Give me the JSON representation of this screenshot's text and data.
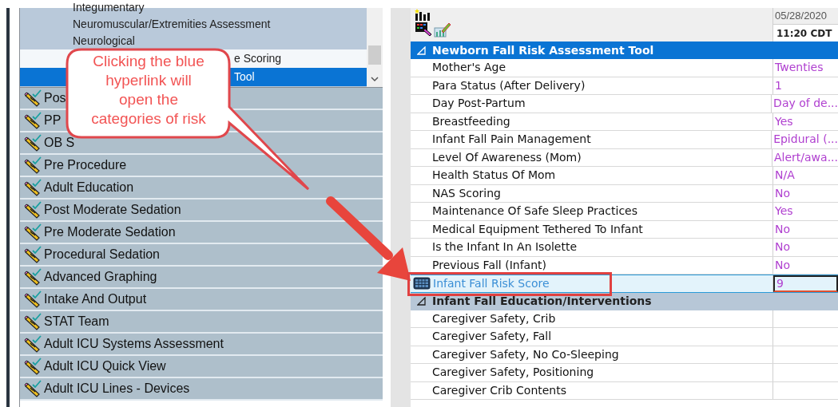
{
  "left_panel": {
    "list_items": [
      {
        "label": "Integumentary",
        "selected": false,
        "highlighted": false
      },
      {
        "label": "Neuromuscular/Extremities Assessment",
        "selected": false,
        "highlighted": false
      },
      {
        "label": "Neurological",
        "selected": false,
        "highlighted": false
      },
      {
        "label": "e Scoring",
        "selected": false,
        "highlighted": true
      },
      {
        "label": "Tool",
        "selected": true,
        "highlighted": false
      }
    ],
    "categories": [
      {
        "label": "Pos"
      },
      {
        "label": "PP"
      },
      {
        "label": "OB S"
      },
      {
        "label": "Pre Procedure"
      },
      {
        "label": "Adult Education"
      },
      {
        "label": "Post Moderate Sedation"
      },
      {
        "label": "Pre Moderate Sedation"
      },
      {
        "label": "Procedural Sedation"
      },
      {
        "label": "Advanced Graphing"
      },
      {
        "label": "Intake And Output"
      },
      {
        "label": "STAT Team"
      },
      {
        "label": "Adult ICU Systems Assessment"
      },
      {
        "label": "Adult ICU Quick View"
      },
      {
        "label": "Adult ICU Lines - Devices"
      }
    ]
  },
  "callout": {
    "text": "Clicking the blue hyperlink will open the categories of risk"
  },
  "flowsheet": {
    "date": "05/28/2020",
    "time": "11:20 CDT",
    "sections": [
      {
        "title": "Newborn Fall Risk Assessment Tool",
        "expanded": true,
        "selected": true,
        "rows": [
          {
            "kind": "field",
            "label": "Mother's Age",
            "value": "Twenties"
          },
          {
            "kind": "field",
            "label": "Para Status (After Delivery)",
            "value": "1"
          },
          {
            "kind": "field",
            "label": "Day Post-Partum",
            "value": "Day of de..."
          },
          {
            "kind": "field",
            "label": "Breastfeeding",
            "value": "Yes"
          },
          {
            "kind": "field",
            "label": "Infant Fall Pain Management",
            "value": "Epidural (..."
          },
          {
            "kind": "field",
            "label": "Level Of Awareness (Mom)",
            "value": "Alert/awa..."
          },
          {
            "kind": "field",
            "label": "Health Status Of Mom",
            "value": "N/A"
          },
          {
            "kind": "field",
            "label": "NAS Scoring",
            "value": "No"
          },
          {
            "kind": "field",
            "label": "Maintenance Of Safe Sleep Practices",
            "value": "Yes"
          },
          {
            "kind": "field",
            "label": "Medical Equipment Tethered To Infant",
            "value": "No"
          },
          {
            "kind": "field",
            "label": "Is the Infant In An Isolette",
            "value": "No"
          },
          {
            "kind": "field",
            "label": "Previous Fall (Infant)",
            "value": "No"
          },
          {
            "kind": "calculation",
            "label": "Infant Fall Risk Score",
            "value": "9",
            "highlighted": true
          }
        ]
      },
      {
        "title": "Infant Fall Education/Interventions",
        "expanded": true,
        "selected": false,
        "rows": [
          {
            "kind": "field",
            "label": "Caregiver Safety, Crib"
          },
          {
            "kind": "field",
            "label": "Caregiver Safety, Fall"
          },
          {
            "kind": "field",
            "label": "Caregiver Safety, No Co-Sleeping"
          },
          {
            "kind": "field",
            "label": "Caregiver Safety, Positioning"
          },
          {
            "kind": "field",
            "label": "Caregiver Crib Contents"
          }
        ]
      }
    ]
  }
}
